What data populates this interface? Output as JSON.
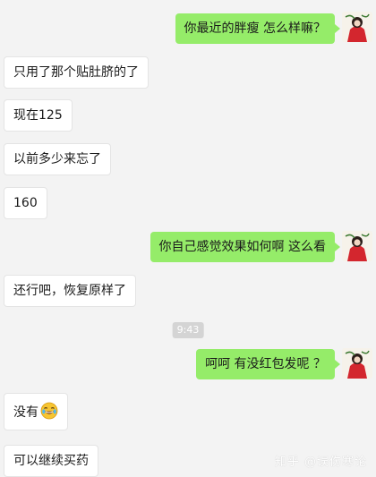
{
  "messages": [
    {
      "side": "out",
      "text": "你最近的胖瘦 怎么样嘛？"
    },
    {
      "side": "in",
      "text": "只用了那个贴肚脐的了"
    },
    {
      "side": "in",
      "text": "现在125"
    },
    {
      "side": "in",
      "text": "以前多少来忘了"
    },
    {
      "side": "in",
      "text": "160"
    },
    {
      "side": "out",
      "text": "你自己感觉效果如何啊   这么看"
    },
    {
      "side": "in",
      "text": "还行吧，恢复原样了"
    },
    {
      "side": "out",
      "text": "呵呵    有没红包发呢 ？"
    },
    {
      "side": "in",
      "text": "没有",
      "emoji": "laughing-crying-emoji"
    },
    {
      "side": "in",
      "text": "可以继续买药"
    }
  ],
  "timestamp": "9:43",
  "watermark": "知乎 @误伤寒论",
  "colors": {
    "background": "#f3f3f3",
    "outgoing_bubble": "#95ec69",
    "incoming_bubble": "#ffffff"
  }
}
